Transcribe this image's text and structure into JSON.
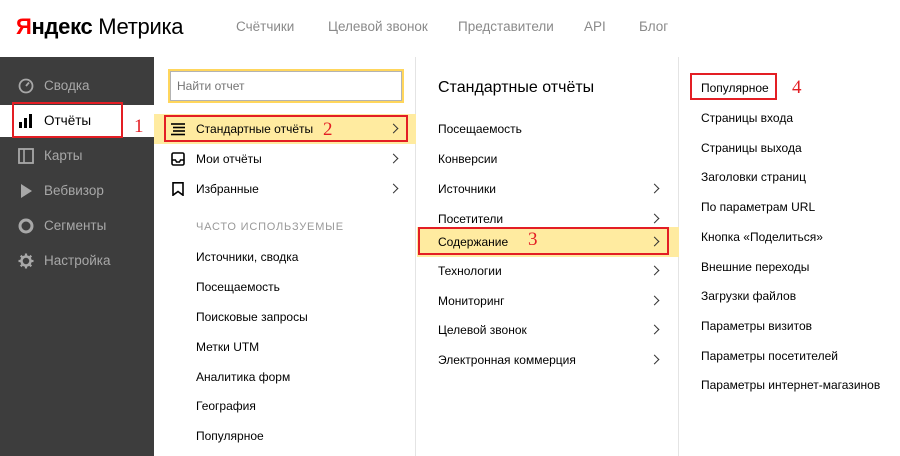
{
  "header": {
    "logo_part1": "Я",
    "logo_part2": "ндекс",
    "logo_part3": " Метрика",
    "nav": [
      "Счётчики",
      "Целевой звонок",
      "Представители",
      "API",
      "Блог"
    ]
  },
  "sidebar": {
    "items": [
      {
        "label": "Сводка",
        "icon": "gauge-icon"
      },
      {
        "label": "Отчёты",
        "icon": "bar-chart-icon",
        "active": true
      },
      {
        "label": "Карты",
        "icon": "map-icon"
      },
      {
        "label": "Вебвизор",
        "icon": "play-icon"
      },
      {
        "label": "Сегменты",
        "icon": "pie-icon"
      },
      {
        "label": "Настройка",
        "icon": "gear-icon"
      }
    ]
  },
  "reports_menu": {
    "search_placeholder": "Найти отчет",
    "items": [
      {
        "label": "Стандартные отчёты",
        "icon": "list-icon",
        "highlighted": true
      },
      {
        "label": "Мои отчёты",
        "icon": "inbox-icon"
      },
      {
        "label": "Избранные",
        "icon": "bookmark-icon"
      }
    ],
    "frequent_heading": "ЧАСТО ИСПОЛЬЗУЕМЫЕ",
    "frequent": [
      "Источники, сводка",
      "Посещаемость",
      "Поисковые запросы",
      "Метки UTM",
      "Аналитика форм",
      "География",
      "Популярное"
    ]
  },
  "standard_reports": {
    "title": "Стандартные отчёты",
    "items": [
      {
        "label": "Посещаемость",
        "has_submenu": false
      },
      {
        "label": "Конверсии",
        "has_submenu": false
      },
      {
        "label": "Источники",
        "has_submenu": true
      },
      {
        "label": "Посетители",
        "has_submenu": true
      },
      {
        "label": "Содержание",
        "has_submenu": true,
        "highlighted": true
      },
      {
        "label": "Технологии",
        "has_submenu": true
      },
      {
        "label": "Мониторинг",
        "has_submenu": true
      },
      {
        "label": "Целевой звонок",
        "has_submenu": true
      },
      {
        "label": "Электронная коммерция",
        "has_submenu": true
      }
    ]
  },
  "content_reports": {
    "items": [
      "Популярное",
      "Страницы входа",
      "Страницы выхода",
      "Заголовки страниц",
      "По параметрам URL",
      "Кнопка «Поделиться»",
      "Внешние переходы",
      "Загрузки файлов",
      "Параметры визитов",
      "Параметры посетителей",
      "Параметры интернет-магазинов"
    ]
  },
  "annotations": {
    "step1": "1",
    "step2": "2",
    "step3": "3",
    "step4": "4"
  },
  "colors": {
    "accent_red": "#e31e24",
    "highlight": "#ffeba0",
    "sidebar_bg": "#3d3d3d",
    "logo_red": "#ff0000"
  }
}
